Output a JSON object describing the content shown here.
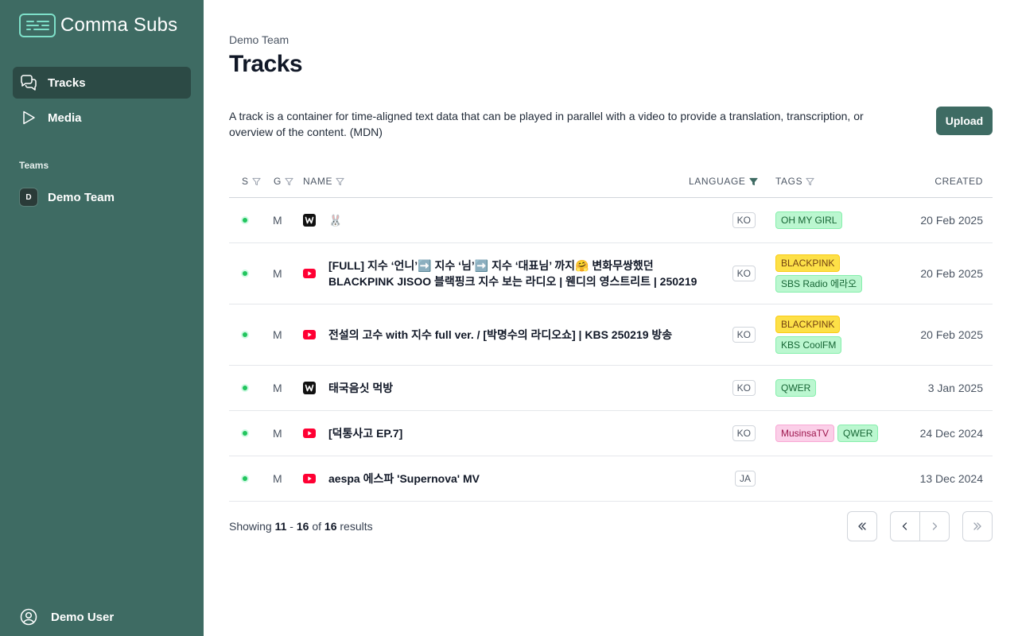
{
  "app": {
    "name": "Comma Subs"
  },
  "sidebar": {
    "nav": [
      {
        "label": "Tracks",
        "icon": "chat-bubbles-icon",
        "active": true
      },
      {
        "label": "Media",
        "icon": "play-icon",
        "active": false
      }
    ],
    "teams_heading": "Teams",
    "teams": [
      {
        "initial": "D",
        "name": "Demo Team"
      }
    ],
    "user": {
      "name": "Demo User",
      "icon": "user-circle-icon"
    }
  },
  "main": {
    "breadcrumb": "Demo Team",
    "title": "Tracks",
    "description": "A track is a container for time-aligned text data that can be played in parallel with a video to provide a translation, transcription, or overview of the content. (MDN)",
    "upload_label": "Upload"
  },
  "table": {
    "columns": {
      "status": "S",
      "gender": "G",
      "name": "NAME",
      "language": "LANGUAGE",
      "tags": "TAGS",
      "created": "CREATED"
    },
    "rows": [
      {
        "gender": "M",
        "source": "weverse",
        "name": "🐰",
        "language": "KO",
        "tags": [
          {
            "label": "OH MY GIRL",
            "color": "green"
          }
        ],
        "created": "20 Feb 2025"
      },
      {
        "gender": "M",
        "source": "youtube",
        "name": "[FULL] 지수 ‘언니’➡️ 지수 ‘님’➡️ 지수 ‘대표님’ 까지🤗 변화무쌍했던 BLACKPINK JISOO 블랙핑크 지수 보는 라디오 | 웬디의 영스트리트 | 250219",
        "language": "KO",
        "tags": [
          {
            "label": "BLACKPINK",
            "color": "yellow"
          },
          {
            "label": "SBS Radio 에라오",
            "color": "green"
          }
        ],
        "created": "20 Feb 2025"
      },
      {
        "gender": "M",
        "source": "youtube",
        "name": "전설의 고수 with 지수 full ver. / [박명수의 라디오쇼] | KBS 250219 방송",
        "language": "KO",
        "tags": [
          {
            "label": "BLACKPINK",
            "color": "yellow"
          },
          {
            "label": "KBS CoolFM",
            "color": "green"
          }
        ],
        "created": "20 Feb 2025"
      },
      {
        "gender": "M",
        "source": "weverse",
        "name": "태국음싯 먹방",
        "language": "KO",
        "tags": [
          {
            "label": "QWER",
            "color": "green"
          }
        ],
        "created": "3 Jan 2025"
      },
      {
        "gender": "M",
        "source": "youtube",
        "name": "[덕통사고 EP.7]",
        "language": "KO",
        "tags": [
          {
            "label": "MusinsaTV",
            "color": "pink"
          },
          {
            "label": "QWER",
            "color": "green"
          }
        ],
        "tags_inline": true,
        "created": "24 Dec 2024"
      },
      {
        "gender": "M",
        "source": "youtube",
        "name": "aespa 에스파 'Supernova' MV",
        "language": "JA",
        "tags": [],
        "created": "13 Dec 2024"
      }
    ]
  },
  "pagination": {
    "prefix": "Showing",
    "start": "11",
    "sep": "-",
    "end": "16",
    "of": "of",
    "total": "16",
    "suffix": "results"
  },
  "colors": {
    "sidebar": "#3e6b63",
    "active_nav": "#2c4a45",
    "accent": "#3e6b63",
    "status_online": "#22c55e"
  }
}
